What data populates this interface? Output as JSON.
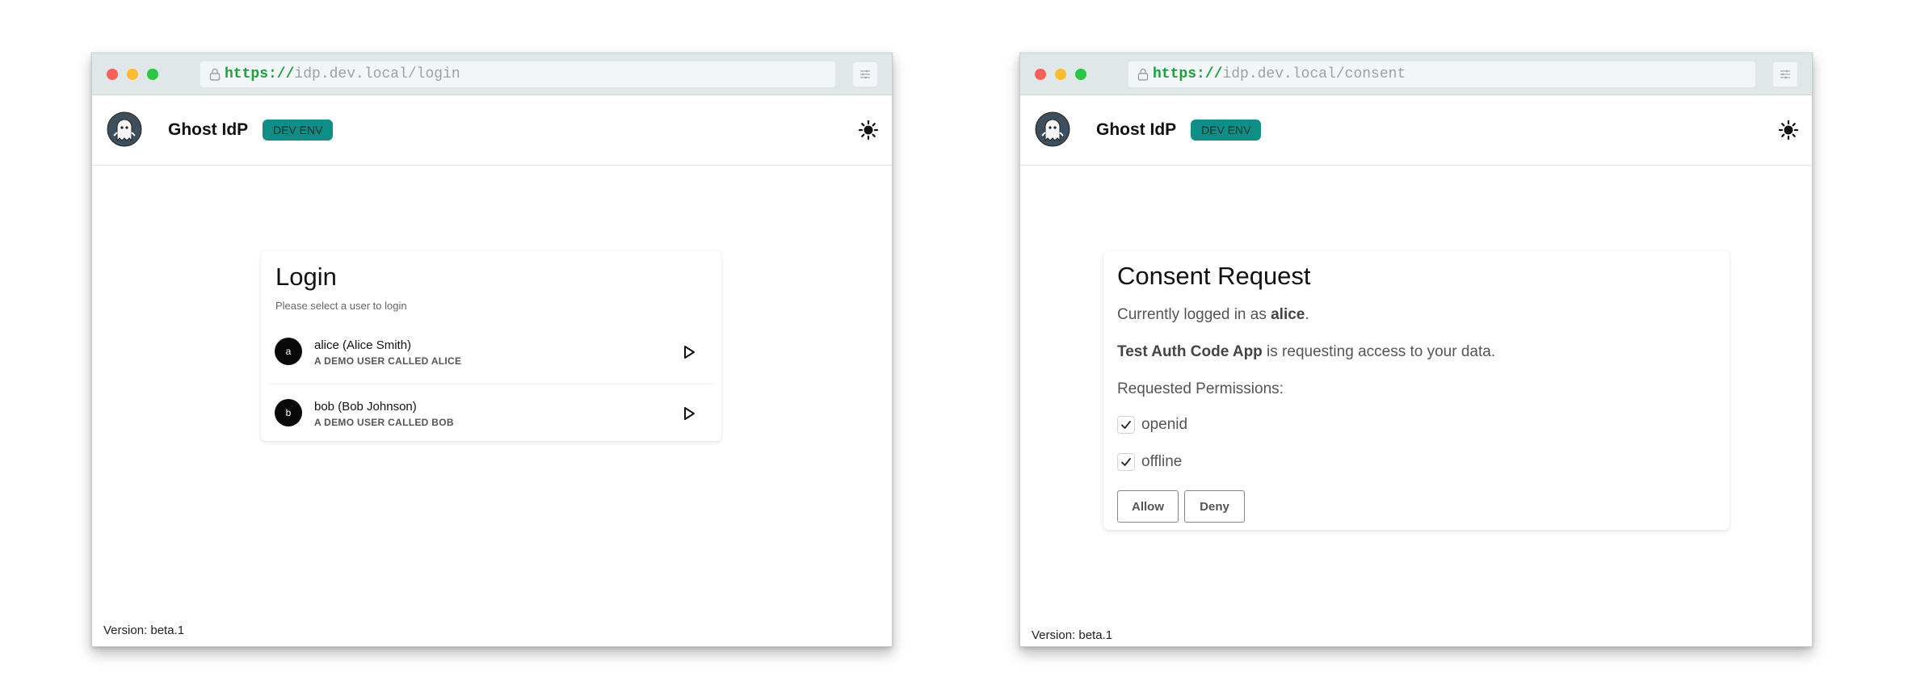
{
  "login_window": {
    "url": {
      "scheme": "https://",
      "rest": "idp.dev.local/login"
    },
    "header": {
      "title": "Ghost IdP",
      "badge": "DEV ENV"
    },
    "card": {
      "title": "Login",
      "subtitle": "Please select a user to login",
      "users": [
        {
          "initial": "a",
          "name": "alice (Alice Smith)",
          "description": "A DEMO USER CALLED ALICE"
        },
        {
          "initial": "b",
          "name": "bob (Bob Johnson)",
          "description": "A DEMO USER CALLED BOB"
        }
      ]
    },
    "version": "Version: beta.1"
  },
  "consent_window": {
    "url": {
      "scheme": "https://",
      "rest": "idp.dev.local/consent"
    },
    "header": {
      "title": "Ghost IdP",
      "badge": "DEV ENV"
    },
    "card": {
      "title": "Consent Request",
      "logged_in_prefix": "Currently logged in as ",
      "logged_in_user": "alice",
      "logged_in_suffix": ".",
      "app_name": "Test Auth Code App",
      "requesting_text": " is requesting access to your data.",
      "permissions_label": "Requested Permissions:",
      "permissions": [
        {
          "name": "openid",
          "checked": true
        },
        {
          "name": "offline",
          "checked": true
        }
      ],
      "allow_label": "Allow",
      "deny_label": "Deny"
    },
    "version": "Version: beta.1"
  },
  "colors": {
    "badge_bg": "#0d8f87",
    "chrome_bar": "#dfe7e8",
    "url_scheme": "#19a33b",
    "traffic_red": "#fe5f57",
    "traffic_yellow": "#febc2e",
    "traffic_green": "#28c840"
  },
  "icons": {
    "logo": "ghost-logo-icon",
    "theme_toggle": "sun-icon",
    "lock": "lock-icon",
    "menu": "menu-icon",
    "user_action": "play-icon",
    "permission": "checkmark-icon"
  }
}
